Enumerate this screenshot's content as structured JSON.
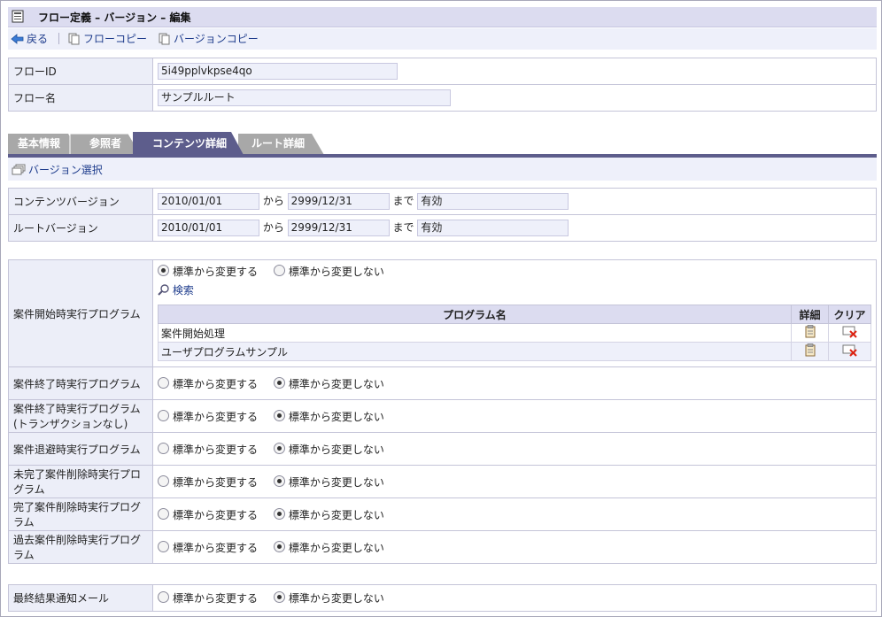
{
  "title": "フロー定義 – バージョン – 編集",
  "toolbar": {
    "back": "戻る",
    "flow_copy": "フローコピー",
    "version_copy": "バージョンコピー"
  },
  "flow": {
    "id_label": "フローID",
    "id_value": "5i49pplvkpse4qo",
    "name_label": "フロー名",
    "name_value": "サンプルルート"
  },
  "tabs": [
    "基本情報",
    "参照者",
    "コンテンツ詳細",
    "ルート詳細"
  ],
  "version_select": "バージョン選択",
  "versions": {
    "from_word": "から",
    "until_word": "まで",
    "content": {
      "label": "コンテンツバージョン",
      "start": "2010/01/01",
      "end": "2999/12/31",
      "status": "有効"
    },
    "route": {
      "label": "ルートバージョン",
      "start": "2010/01/01",
      "end": "2999/12/31",
      "status": "有効"
    }
  },
  "radio": {
    "change": "標準から変更する",
    "no_change": "標準から変更しない"
  },
  "programs": {
    "start_label": "案件開始時実行プログラム",
    "search": "検索",
    "table_headers": {
      "name": "プログラム名",
      "detail": "詳細",
      "clear": "クリア"
    },
    "rows": [
      "案件開始処理",
      "ユーザプログラムサンプル"
    ],
    "others": [
      "案件終了時実行プログラム",
      "案件終了時実行プログラム(トランザクションなし)",
      "案件退避時実行プログラム",
      "未完了案件削除時実行プログラム",
      "完了案件削除時実行プログラム",
      "過去案件削除時実行プログラム"
    ]
  },
  "mail_label": "最終結果通知メール",
  "colors": {
    "tab_active": "#5d5d8c",
    "tab_inactive": "#a8a8a8",
    "header_bg": "#dcdcf0",
    "link": "#1e3c8c"
  }
}
